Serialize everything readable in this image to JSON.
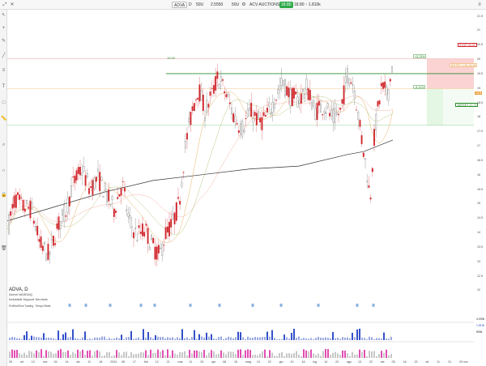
{
  "toolbar": {
    "symbol": "ADVA",
    "interval": "D",
    "items": [
      "50U",
      "50U",
      "2.5550"
    ],
    "company": "ACV AUCTIONS INC.",
    "price_badge": "18.80",
    "extra": "18.80 ↑ 1.810k"
  },
  "symbol_info": {
    "title": "ADVA, D",
    "exchange": "Azioni NASDAQ",
    "sector": "Industrial Support Services",
    "studies": "ProRealTime Trading · Tempo Reale"
  },
  "price_axis": {
    "ticks": [
      "21.5",
      "21",
      "20.5",
      "20",
      "19.5",
      "19",
      "18.5",
      "18",
      "17.5",
      "17",
      "16.5",
      "16",
      "15.5",
      "15",
      "14.5",
      "14",
      "13.5",
      "13",
      "12.5",
      "12"
    ],
    "current_price": "18.8"
  },
  "levels": {
    "resistance_label": "19.00",
    "stop_label": "STOP 20.01",
    "entry_label": "ENTRY LON 18.98",
    "target_label": "TARGET 17.71",
    "pct_up": "+3.79%",
    "pct_down": "-8.14%"
  },
  "volume_axis": {
    "labels": [
      "4.000k",
      "1.810k",
      "500k"
    ]
  },
  "date_axis": {
    "labels": [
      "25",
      "ott",
      "13",
      "nov",
      "04",
      "14",
      "dic",
      "11",
      "18",
      "2024",
      "08",
      "17",
      "feb",
      "12",
      "21",
      "mar",
      "11",
      "20",
      "apr",
      "08",
      "15",
      "mag",
      "13",
      "22",
      "giu",
      "10",
      "18",
      "lug",
      "14",
      "22",
      "ago",
      "13",
      "22",
      "set",
      "05",
      "16",
      "23",
      "ott",
      "11",
      "21",
      "29 nov"
    ]
  },
  "colors": {
    "up": "#5b5b5b",
    "down": "#d0262c",
    "ma200": "#333333",
    "resistance": "#2e8b2e",
    "stop_zone": "#fbd3d3",
    "target_zone": "#c9efc9",
    "volume": "#3451c9"
  },
  "icons": [
    "cursor-icon",
    "crosshair-icon",
    "pencil-icon",
    "trendline-icon",
    "fibonacci-icon",
    "text-icon",
    "shapes-icon",
    "ruler-icon",
    "zoom-icon",
    "magnet-icon",
    "lock-icon",
    "trash-icon"
  ]
}
